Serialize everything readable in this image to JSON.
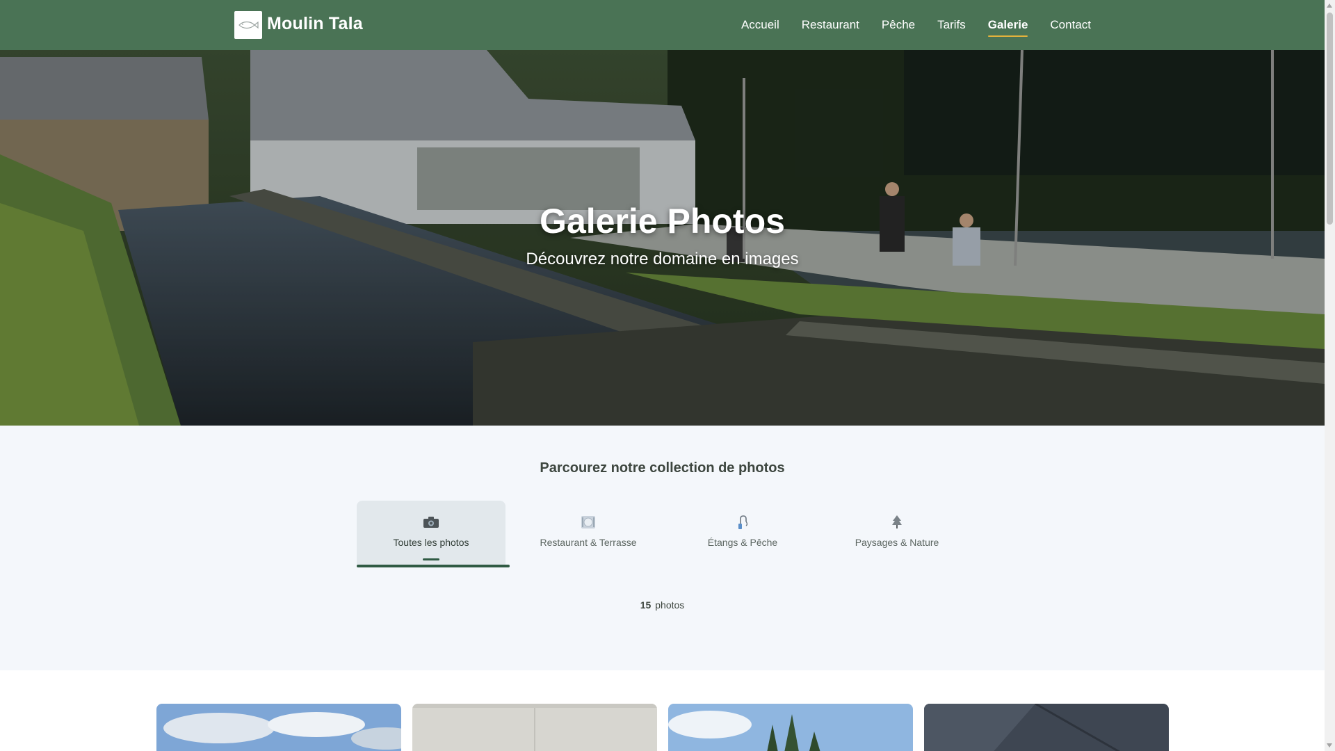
{
  "brand": {
    "name": "Moulin Tala",
    "logo_icon": "fish-icon"
  },
  "nav": {
    "items": [
      {
        "label": "Accueil",
        "active": false
      },
      {
        "label": "Restaurant",
        "active": false
      },
      {
        "label": "Pêche",
        "active": false
      },
      {
        "label": "Tarifs",
        "active": false
      },
      {
        "label": "Galerie",
        "active": true
      },
      {
        "label": "Contact",
        "active": false
      }
    ]
  },
  "hero": {
    "title": "Galerie Photos",
    "subtitle": "Découvrez notre domaine en images"
  },
  "filters": {
    "heading": "Parcourez notre collection de photos",
    "tabs": [
      {
        "label": "Toutes les photos",
        "icon": "camera-icon",
        "active": true
      },
      {
        "label": "Restaurant & Terrasse",
        "icon": "plate-icon",
        "active": false
      },
      {
        "label": "Étangs & Pêche",
        "icon": "fishing-icon",
        "active": false
      },
      {
        "label": "Paysages & Nature",
        "icon": "tree-icon",
        "active": false
      }
    ],
    "count_number": "15",
    "count_label": "photos"
  },
  "colors": {
    "header": "#4a7355",
    "accent": "#e3b23c",
    "tab_indicator": "#2f5a43",
    "section_bg": "#f4f7fb"
  }
}
